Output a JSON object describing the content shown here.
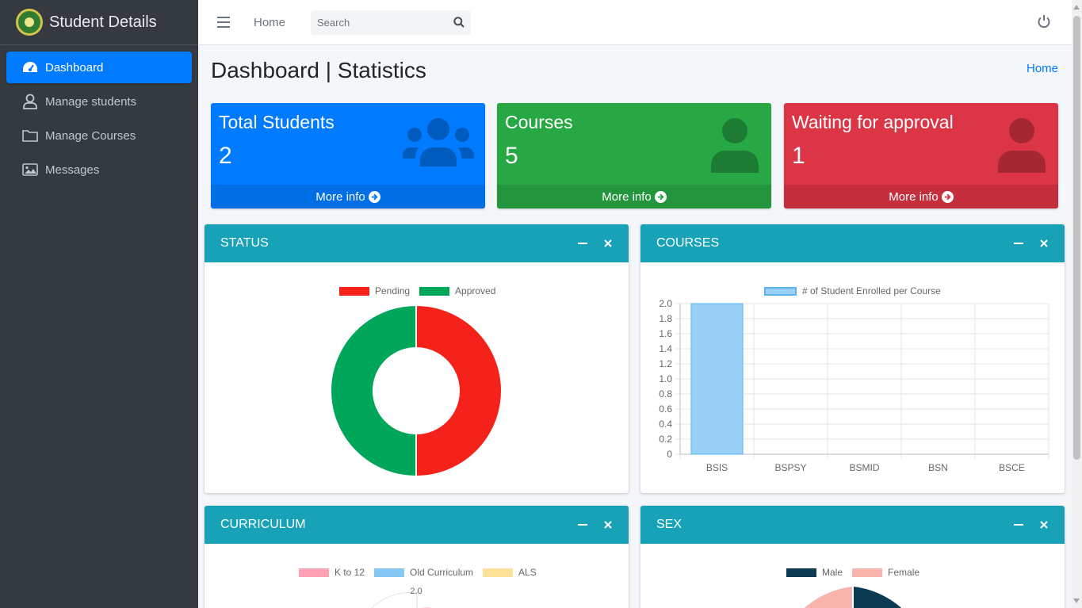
{
  "brand": {
    "title": "Student Details"
  },
  "sidebar": {
    "items": [
      {
        "label": "Dashboard",
        "icon": "speedometer-icon",
        "active": true
      },
      {
        "label": "Manage students",
        "icon": "user-icon"
      },
      {
        "label": "Manage Courses",
        "icon": "folder-icon"
      },
      {
        "label": "Messages",
        "icon": "image-icon"
      }
    ]
  },
  "topbar": {
    "home_label": "Home",
    "search_placeholder": "Search"
  },
  "page": {
    "title": "Dashboard | Statistics",
    "breadcrumb": "Home"
  },
  "boxes": [
    {
      "title": "Total Students",
      "value": "2",
      "footer": "More info",
      "color": "#007bff",
      "icon": "users-icon"
    },
    {
      "title": "Courses",
      "value": "5",
      "footer": "More info",
      "color": "#28a745",
      "icon": "user-icon"
    },
    {
      "title": "Waiting for approval",
      "value": "1",
      "footer": "More info",
      "color": "#dc3545",
      "icon": "user-icon"
    }
  ],
  "cards": {
    "status": {
      "title": "STATUS"
    },
    "courses": {
      "title": "COURSES"
    },
    "curriculum": {
      "title": "CURRICULUM"
    },
    "sex": {
      "title": "SEX"
    }
  },
  "chart_data": [
    {
      "type": "pie",
      "variant": "doughnut",
      "labels": [
        "Pending",
        "Approved"
      ],
      "values": [
        1,
        1
      ],
      "colors": [
        "#f5221b",
        "#00a65a"
      ],
      "legend": "top"
    },
    {
      "type": "bar",
      "categories": [
        "BSIS",
        "BSPSY",
        "BSMID",
        "BSN",
        "BSCE"
      ],
      "series": [
        {
          "name": "# of Student Enrolled per Course",
          "values": [
            2,
            0,
            0,
            0,
            0
          ]
        }
      ],
      "ylim": [
        0,
        2
      ],
      "yticks": [
        "0",
        "0.2",
        "0.4",
        "0.6",
        "0.8",
        "1.0",
        "1.2",
        "1.4",
        "1.6",
        "1.8",
        "2.0"
      ],
      "grid": true,
      "legend": "top",
      "colors": [
        "#9ad0f5"
      ]
    },
    {
      "type": "pie",
      "variant": "polar",
      "labels": [
        "K to 12",
        "Old Curriculum",
        "ALS"
      ],
      "colors": [
        "#ffa1b5",
        "#86c7f3",
        "#ffe29a"
      ],
      "visible_tick": "2.0",
      "legend": "top"
    },
    {
      "type": "pie",
      "labels": [
        "Male",
        "Female"
      ],
      "colors": [
        "#0b3a53",
        "#f8b5ad"
      ],
      "legend": "top"
    }
  ]
}
